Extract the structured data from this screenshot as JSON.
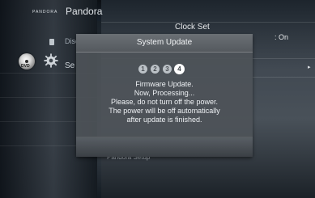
{
  "background": {
    "top_left_small_brand": "PANDORA",
    "top_left_brand": "Pandora",
    "disc_label": "Disc",
    "setup_label_partial": "Se",
    "right_panel": {
      "clock_set_label": "Clock Set",
      "clock_set_value": ": On",
      "bottom_label": "Pandora Setup"
    }
  },
  "dialog": {
    "title": "System Update",
    "steps": [
      "1",
      "2",
      "3",
      "4"
    ],
    "active_step": 4,
    "message": [
      "Firmware Update.",
      "Now, Processing...",
      "Please, do not turn off the power.",
      "The power will be off automatically",
      "after update is finished."
    ]
  },
  "icons": {
    "disc": "disc-icon",
    "gear": "gear-icon",
    "small_disc": "small-disc-icon",
    "chevron": "chevron-right-icon"
  },
  "colors": {
    "dialog_bg": "#4E5358",
    "text": "#EEF1F4",
    "active_step": "#FFFFFF"
  }
}
